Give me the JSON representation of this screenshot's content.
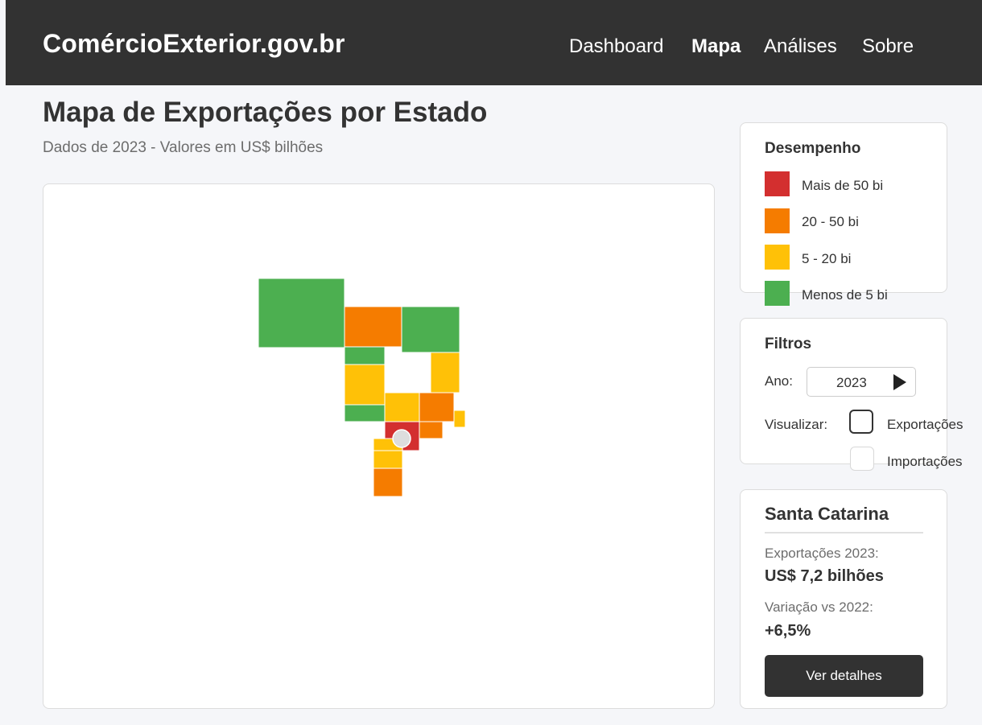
{
  "header": {
    "brand": "ComércioExterior.gov.br",
    "nav": [
      "Dashboard",
      "Mapa",
      "Análises",
      "Sobre"
    ],
    "active_nav": "Mapa"
  },
  "page": {
    "title": "Mapa de Exportações por Estado",
    "subtitle": "Dados de 2023 - Valores em US$ bilhões"
  },
  "colors": {
    "above_50": "#d32f2f",
    "from_20_to_50": "#f57c00",
    "from_5_to_20": "#ffc107",
    "below_5": "#4caf50",
    "marker": "#dddddd"
  },
  "legend": {
    "title": "Desempenho",
    "items": [
      {
        "label": "Mais de 50 bi",
        "color": "#d32f2f"
      },
      {
        "label": "20 - 50 bi",
        "color": "#f57c00"
      },
      {
        "label": "5 - 20 bi",
        "color": "#ffc107"
      },
      {
        "label": "Menos de 5 bi",
        "color": "#4caf50"
      }
    ]
  },
  "filters": {
    "title": "Filtros",
    "year_label": "Ano:",
    "year_value": "2023",
    "view_label": "Visualizar:",
    "options": [
      {
        "label": "Exportações",
        "checked": true
      },
      {
        "label": "Importações",
        "checked": false
      }
    ]
  },
  "details": {
    "state": "Santa Catarina",
    "exports_label": "Exportações 2023:",
    "exports_value": "US$ 7,2 bilhões",
    "change_label": "Variação vs 2022:",
    "change_value": "+6,5%",
    "button_label": "Ver detalhes"
  },
  "map": {
    "state_categories": [
      "below_5",
      "from_20_to_50",
      "below_5",
      "below_5",
      "from_5_to_20",
      "from_5_to_20",
      "below_5",
      "from_5_to_20",
      "from_20_to_50",
      "from_5_to_20",
      "above_50",
      "from_20_to_50",
      "from_5_to_20",
      "from_5_to_20",
      "from_20_to_50"
    ]
  }
}
